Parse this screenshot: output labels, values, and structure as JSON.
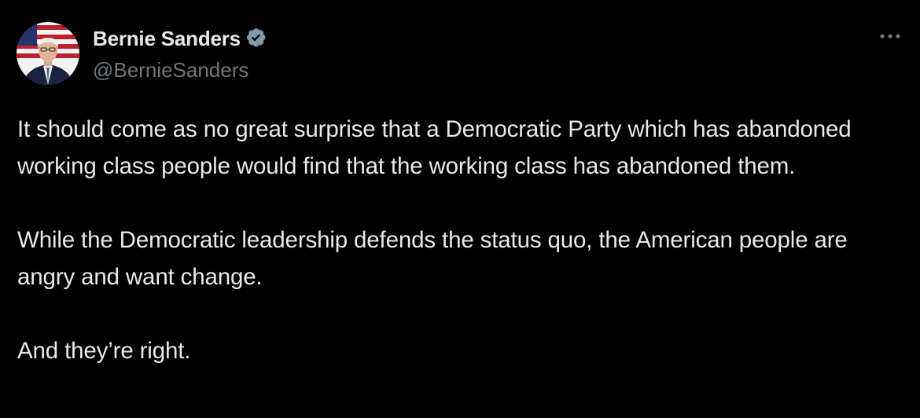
{
  "tweet": {
    "author": {
      "display_name": "Bernie Sanders",
      "handle": "@BernieSanders",
      "verified_icon": "verified-badge-icon",
      "avatar_icon": "profile-photo"
    },
    "more_icon": "more-options-icon",
    "paragraphs": [
      "It should come as no great surprise that a Democratic Party which has abandoned working class people would find that the working class has abandoned them.",
      "While the Democratic leadership defends the status quo, the American people are angry and want change.",
      "And they’re right."
    ]
  },
  "colors": {
    "background": "#000000",
    "text_primary": "#e7e9ea",
    "text_secondary": "#71767b",
    "verified_badge": "#829aab"
  }
}
